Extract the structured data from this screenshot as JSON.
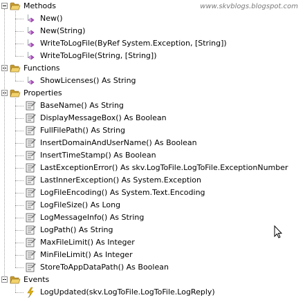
{
  "watermark": "www.skvblogs.blogspot.com",
  "groups": [
    {
      "label": "Methods",
      "icon": "folder-open-icon",
      "expanded": true,
      "items": [
        {
          "label": "New()",
          "icon": "method-icon"
        },
        {
          "label": "New(String)",
          "icon": "method-icon"
        },
        {
          "label": "WriteToLogFile(ByRef System.Exception, [String])",
          "icon": "method-icon"
        },
        {
          "label": "WriteToLogFile(String, [String])",
          "icon": "method-icon"
        }
      ]
    },
    {
      "label": "Functions",
      "icon": "folder-open-icon",
      "expanded": true,
      "items": [
        {
          "label": "ShowLicenses() As String",
          "icon": "method-icon"
        }
      ]
    },
    {
      "label": "Properties",
      "icon": "folder-open-icon",
      "expanded": true,
      "items": [
        {
          "label": "BaseName() As String",
          "icon": "property-icon"
        },
        {
          "label": "DisplayMessageBox() As Boolean",
          "icon": "property-icon"
        },
        {
          "label": "FullFilePath() As String",
          "icon": "property-icon"
        },
        {
          "label": "InsertDomainAndUserName() As Boolean",
          "icon": "property-icon"
        },
        {
          "label": "InsertTimeStamp() As Boolean",
          "icon": "property-icon"
        },
        {
          "label": "LastExceptionError() As skv.LogToFile.LogToFile.ExceptionNumber",
          "icon": "property-icon"
        },
        {
          "label": "LastInnerException() As System.Exception",
          "icon": "property-icon"
        },
        {
          "label": "LogFileEncoding() As System.Text.Encoding",
          "icon": "property-icon"
        },
        {
          "label": "LogFileSize() As Long",
          "icon": "property-icon"
        },
        {
          "label": "LogMessageInfo() As String",
          "icon": "property-icon"
        },
        {
          "label": "LogPath() As String",
          "icon": "property-icon"
        },
        {
          "label": "MaxFileLimit() As Integer",
          "icon": "property-icon"
        },
        {
          "label": "MinFileLimit() As Integer",
          "icon": "property-icon"
        },
        {
          "label": "StoreToAppDataPath() As Boolean",
          "icon": "property-icon"
        }
      ]
    },
    {
      "label": "Events",
      "icon": "folder-open-icon",
      "expanded": true,
      "items": [
        {
          "label": "LogUpdated(skv.LogToFile.LogToFile.LogReply)",
          "icon": "event-icon"
        }
      ]
    }
  ],
  "colors": {
    "folder": "#f2d36b",
    "folder_dark": "#c79a2a",
    "method": "#b04fc2",
    "event": "#e4b400",
    "connector": "#a0a0a0"
  }
}
